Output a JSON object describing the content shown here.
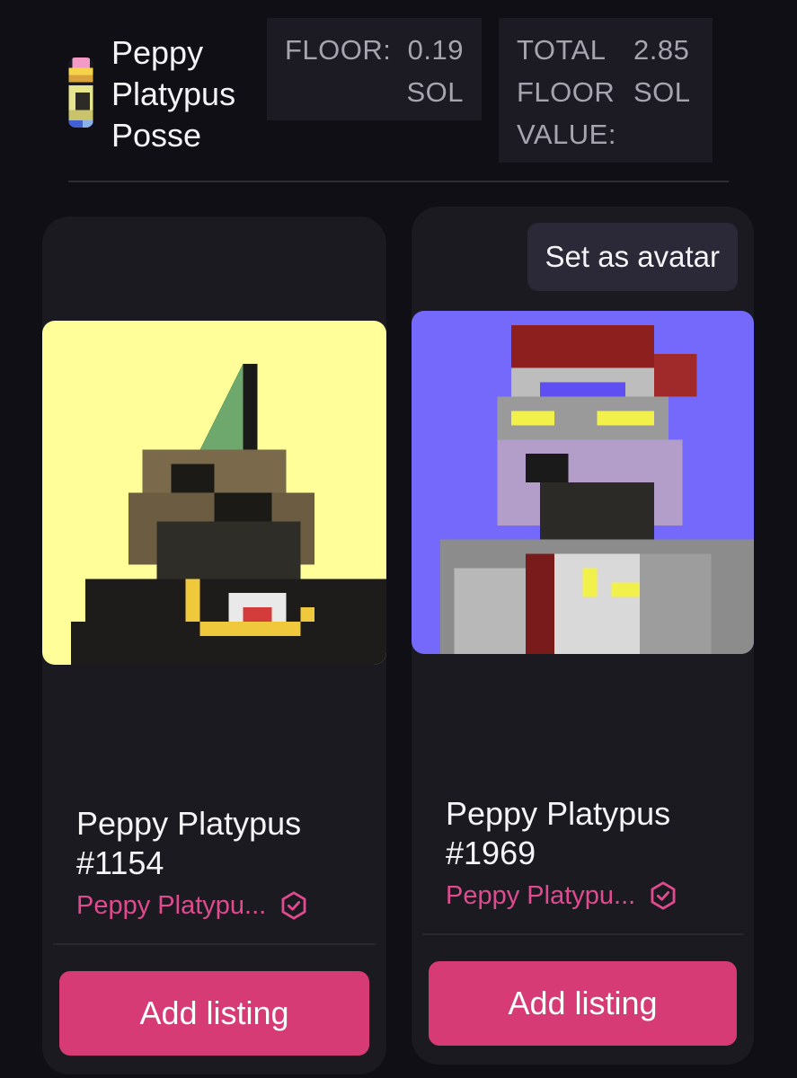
{
  "header": {
    "collection_name": "Peppy Platypus Posse",
    "logo_icon": "collection-logo-icon",
    "floor": {
      "label": "FLOOR:",
      "value": "0.19\nSOL"
    },
    "total_floor": {
      "label": "TOTAL\nFLOOR\nVALUE:",
      "value": "2.85\nSOL"
    }
  },
  "cards": [
    {
      "title": "Peppy Platypus #1154",
      "collection": "Peppy Platypu...",
      "verified_icon": "verified-badge-icon",
      "button": "Add listing",
      "image_background": "#fffe99"
    },
    {
      "title": "Peppy Platypus #1969",
      "collection": "Peppy Platypu...",
      "verified_icon": "verified-badge-icon",
      "button": "Add listing",
      "avatar_button": "Set as avatar",
      "image_background": "#7469fa"
    }
  ],
  "colors": {
    "background": "#100f16",
    "card": "#1b1a21",
    "accent": "#d63b76",
    "collection_text": "#e04a8f"
  }
}
